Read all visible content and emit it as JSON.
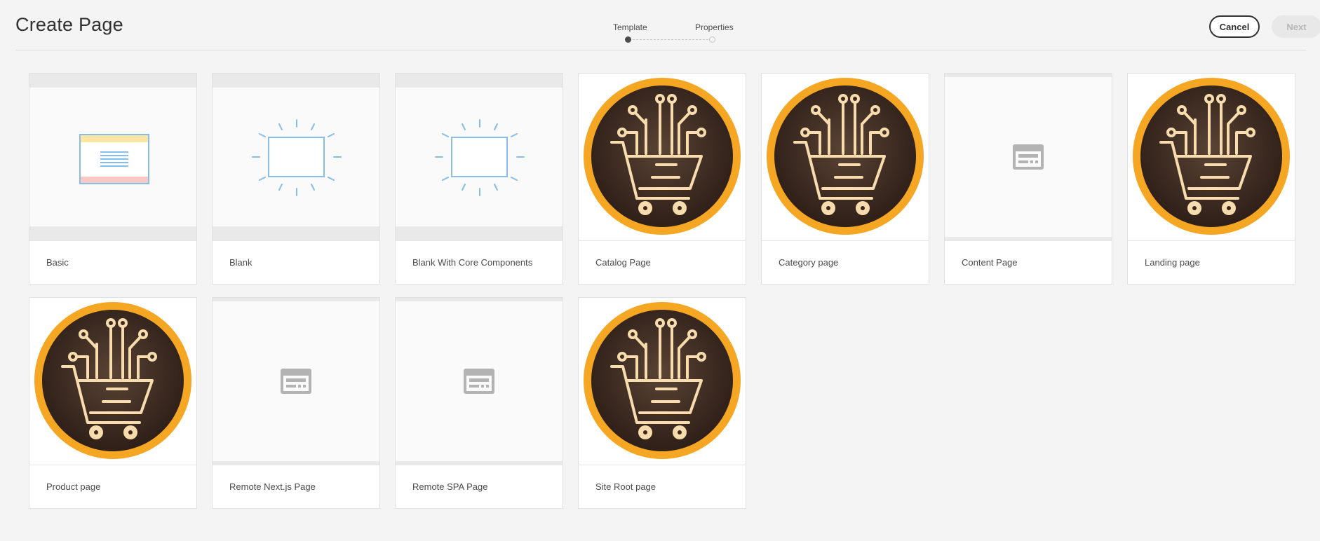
{
  "header": {
    "title": "Create Page",
    "steps": [
      "Template",
      "Properties"
    ],
    "cancel_label": "Cancel",
    "next_label": "Next"
  },
  "colors": {
    "accent_orange": "#f5a623",
    "cart_dark": "#3a2820",
    "cart_line": "#f8dcae",
    "blank_blue": "#87bde9",
    "placeholder_gray": "#b3b3b3"
  },
  "templates": [
    {
      "label": "Basic",
      "icon": "basic-template-icon"
    },
    {
      "label": "Blank",
      "icon": "blank-template-icon"
    },
    {
      "label": "Blank With Core Components",
      "icon": "blank-template-icon"
    },
    {
      "label": "Catalog Page",
      "icon": "shopping-cart-icon"
    },
    {
      "label": "Category page",
      "icon": "shopping-cart-icon"
    },
    {
      "label": "Content Page",
      "icon": "page-placeholder-icon"
    },
    {
      "label": "Landing page",
      "icon": "shopping-cart-icon"
    },
    {
      "label": "Product page",
      "icon": "shopping-cart-icon"
    },
    {
      "label": "Remote Next.js Page",
      "icon": "page-placeholder-icon"
    },
    {
      "label": "Remote SPA Page",
      "icon": "page-placeholder-icon"
    },
    {
      "label": "Site Root page",
      "icon": "shopping-cart-icon"
    }
  ]
}
